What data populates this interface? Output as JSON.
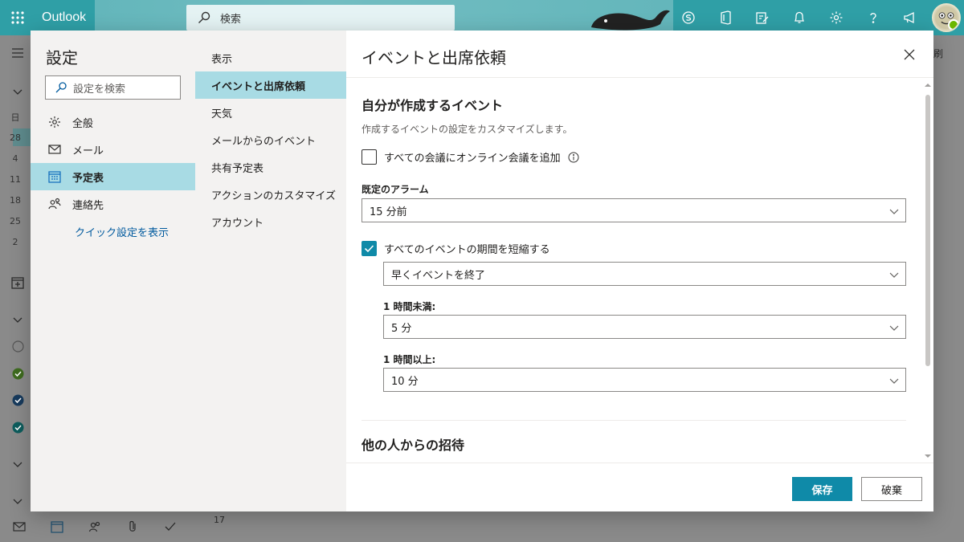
{
  "app": {
    "brand": "Outlook",
    "search_placeholder": "検索"
  },
  "background": {
    "left_numbers": [
      "日",
      "28",
      "4",
      "11",
      "18",
      "25",
      "2"
    ],
    "bottom_day": "17",
    "right_text": "刷"
  },
  "settings": {
    "title": "設定",
    "search_placeholder": "設定を検索",
    "categories": [
      {
        "label": "全般",
        "icon": "gear-icon"
      },
      {
        "label": "メール",
        "icon": "mail-icon"
      },
      {
        "label": "予定表",
        "icon": "calendar-icon",
        "selected": true
      },
      {
        "label": "連絡先",
        "icon": "people-icon"
      }
    ],
    "quick_settings": "クイック設定を表示",
    "subnav": [
      {
        "label": "表示"
      },
      {
        "label": "イベントと出席依頼",
        "selected": true
      },
      {
        "label": "天気"
      },
      {
        "label": "メールからのイベント"
      },
      {
        "label": "共有予定表"
      },
      {
        "label": "アクションのカスタマイズ"
      },
      {
        "label": "アカウント"
      }
    ]
  },
  "panel": {
    "title": "イベントと出席依頼",
    "section1_title": "自分が作成するイベント",
    "section1_desc": "作成するイベントの設定をカスタマイズします。",
    "online_meeting_label": "すべての会議にオンライン会議を追加",
    "online_meeting_checked": false,
    "default_alarm_label": "既定のアラーム",
    "default_alarm_value": "15 分前",
    "shorten_label": "すべてのイベントの期間を短縮する",
    "shorten_checked": true,
    "shorten_mode_value": "早くイベントを終了",
    "under_hour_label": "1 時間未満:",
    "under_hour_value": "5 分",
    "over_hour_label": "1 時間以上:",
    "over_hour_value": "10 分",
    "section2_title": "他の人からの招待"
  },
  "footer": {
    "save": "保存",
    "discard": "破棄"
  },
  "colors": {
    "accent": "#0f8aa8",
    "selected_bg": "#a8dbe4",
    "topbar": "#2f9fa6"
  }
}
